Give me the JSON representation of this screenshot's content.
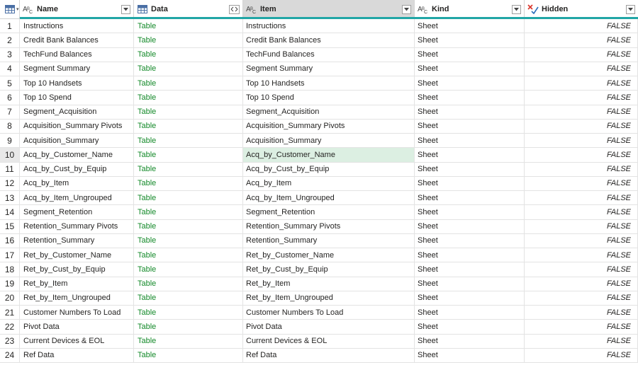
{
  "columns": {
    "name": "Name",
    "data": "Data",
    "item": "Item",
    "kind": "Kind",
    "hidden": "Hidden"
  },
  "type_icons": {
    "table": "table-grid-icon",
    "text": "abc-text-type-icon",
    "logical": "check-x-logical-icon",
    "expand": "expand-arrows-icon",
    "dropdown": "chevron-down-icon"
  },
  "colors": {
    "accent": "#21a6a6",
    "table_link": "#148a2a",
    "selected_cell": "#dcefe2"
  },
  "active_row": 10,
  "rows": [
    {
      "n": "1",
      "name": "Instructions",
      "data": "Table",
      "item": "Instructions",
      "kind": "Sheet",
      "hidden": "FALSE"
    },
    {
      "n": "2",
      "name": "Credit Bank Balances",
      "data": "Table",
      "item": "Credit Bank Balances",
      "kind": "Sheet",
      "hidden": "FALSE"
    },
    {
      "n": "3",
      "name": "TechFund Balances",
      "data": "Table",
      "item": "TechFund Balances",
      "kind": "Sheet",
      "hidden": "FALSE"
    },
    {
      "n": "4",
      "name": "Segment Summary",
      "data": "Table",
      "item": "Segment Summary",
      "kind": "Sheet",
      "hidden": "FALSE"
    },
    {
      "n": "5",
      "name": "Top 10 Handsets",
      "data": "Table",
      "item": "Top 10 Handsets",
      "kind": "Sheet",
      "hidden": "FALSE"
    },
    {
      "n": "6",
      "name": "Top 10 Spend",
      "data": "Table",
      "item": "Top 10 Spend",
      "kind": "Sheet",
      "hidden": "FALSE"
    },
    {
      "n": "7",
      "name": "Segment_Acquisition",
      "data": "Table",
      "item": "Segment_Acquisition",
      "kind": "Sheet",
      "hidden": "FALSE"
    },
    {
      "n": "8",
      "name": "Acquisition_Summary Pivots",
      "data": "Table",
      "item": "Acquisition_Summary Pivots",
      "kind": "Sheet",
      "hidden": "FALSE"
    },
    {
      "n": "9",
      "name": "Acquisition_Summary",
      "data": "Table",
      "item": "Acquisition_Summary",
      "kind": "Sheet",
      "hidden": "FALSE"
    },
    {
      "n": "10",
      "name": "Acq_by_Customer_Name",
      "data": "Table",
      "item": "Acq_by_Customer_Name",
      "kind": "Sheet",
      "hidden": "FALSE"
    },
    {
      "n": "11",
      "name": "Acq_by_Cust_by_Equip",
      "data": "Table",
      "item": "Acq_by_Cust_by_Equip",
      "kind": "Sheet",
      "hidden": "FALSE"
    },
    {
      "n": "12",
      "name": "Acq_by_Item",
      "data": "Table",
      "item": "Acq_by_Item",
      "kind": "Sheet",
      "hidden": "FALSE"
    },
    {
      "n": "13",
      "name": "Acq_by_Item_Ungrouped",
      "data": "Table",
      "item": "Acq_by_Item_Ungrouped",
      "kind": "Sheet",
      "hidden": "FALSE"
    },
    {
      "n": "14",
      "name": "Segment_Retention",
      "data": "Table",
      "item": "Segment_Retention",
      "kind": "Sheet",
      "hidden": "FALSE"
    },
    {
      "n": "15",
      "name": "Retention_Summary Pivots",
      "data": "Table",
      "item": "Retention_Summary Pivots",
      "kind": "Sheet",
      "hidden": "FALSE"
    },
    {
      "n": "16",
      "name": "Retention_Summary",
      "data": "Table",
      "item": "Retention_Summary",
      "kind": "Sheet",
      "hidden": "FALSE"
    },
    {
      "n": "17",
      "name": "Ret_by_Customer_Name",
      "data": "Table",
      "item": "Ret_by_Customer_Name",
      "kind": "Sheet",
      "hidden": "FALSE"
    },
    {
      "n": "18",
      "name": "Ret_by_Cust_by_Equip",
      "data": "Table",
      "item": "Ret_by_Cust_by_Equip",
      "kind": "Sheet",
      "hidden": "FALSE"
    },
    {
      "n": "19",
      "name": "Ret_by_Item",
      "data": "Table",
      "item": "Ret_by_Item",
      "kind": "Sheet",
      "hidden": "FALSE"
    },
    {
      "n": "20",
      "name": "Ret_by_Item_Ungrouped",
      "data": "Table",
      "item": "Ret_by_Item_Ungrouped",
      "kind": "Sheet",
      "hidden": "FALSE"
    },
    {
      "n": "21",
      "name": "Customer Numbers To Load",
      "data": "Table",
      "item": "Customer Numbers To Load",
      "kind": "Sheet",
      "hidden": "FALSE"
    },
    {
      "n": "22",
      "name": "Pivot Data",
      "data": "Table",
      "item": "Pivot Data",
      "kind": "Sheet",
      "hidden": "FALSE"
    },
    {
      "n": "23",
      "name": "Current Devices & EOL",
      "data": "Table",
      "item": "Current Devices & EOL",
      "kind": "Sheet",
      "hidden": "FALSE"
    },
    {
      "n": "24",
      "name": "Ref Data",
      "data": "Table",
      "item": "Ref Data",
      "kind": "Sheet",
      "hidden": "FALSE"
    }
  ]
}
